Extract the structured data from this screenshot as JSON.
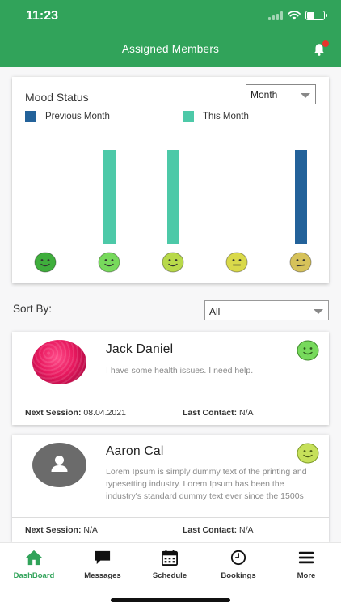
{
  "status_bar": {
    "time": "11:23"
  },
  "header": {
    "title": "Assigned Members"
  },
  "mood_status": {
    "title": "Mood Status",
    "period_select": "Month",
    "legend": [
      {
        "label": "Previous Month",
        "color": "#23629a"
      },
      {
        "label": "This Month",
        "color": "#4dc9a8"
      }
    ],
    "moods": [
      {
        "icon": "happy-face-dark-green-icon",
        "color": "#3fae3c",
        "mouth": "smile"
      },
      {
        "icon": "happy-face-green-icon",
        "color": "#77d95c",
        "mouth": "smile"
      },
      {
        "icon": "happy-face-yellow-green-icon",
        "color": "#b8d94a",
        "mouth": "smile"
      },
      {
        "icon": "neutral-face-yellow-icon",
        "color": "#d9d94a",
        "mouth": "flat"
      },
      {
        "icon": "sad-face-tan-icon",
        "color": "#d6c25a",
        "mouth": "frown"
      }
    ],
    "bars": [
      {
        "mood_index": 1,
        "series": "This Month"
      },
      {
        "mood_index": 2,
        "series": "This Month"
      },
      {
        "mood_index": 4,
        "series": "Previous Month"
      }
    ]
  },
  "sort": {
    "label": "Sort By:",
    "value": "All"
  },
  "members": [
    {
      "name": "Jack Daniel",
      "message": "I have some health issues. I need help.",
      "avatar": "profile-photo",
      "mood_icon": "happy-face-green-icon",
      "next_session_label": "Next Session:",
      "next_session": "08.04.2021",
      "last_contact_label": "Last Contact:",
      "last_contact": "N/A"
    },
    {
      "name": "Aaron Cal",
      "message": "Lorem Ipsum is simply dummy text of the printing and typesetting industry. Lorem Ipsum has been the industry's standard dummy text ever since the 1500s",
      "avatar": "default-user-icon",
      "mood_icon": "happy-face-yellow-green-icon",
      "next_session_label": "Next Session:",
      "next_session": "N/A",
      "last_contact_label": "Last Contact:",
      "last_contact": "N/A"
    }
  ],
  "bottom_nav": [
    {
      "label": "DashBoard",
      "icon": "home-icon",
      "active": true
    },
    {
      "label": "Messages",
      "icon": "chat-icon",
      "active": false
    },
    {
      "label": "Schedule",
      "icon": "calendar-icon",
      "active": false
    },
    {
      "label": "Bookings",
      "icon": "clock-icon",
      "active": false
    },
    {
      "label": "More",
      "icon": "menu-icon",
      "active": false
    }
  ],
  "colors": {
    "primary": "#31a35a",
    "previous_month": "#23629a",
    "this_month": "#4dc9a8"
  }
}
